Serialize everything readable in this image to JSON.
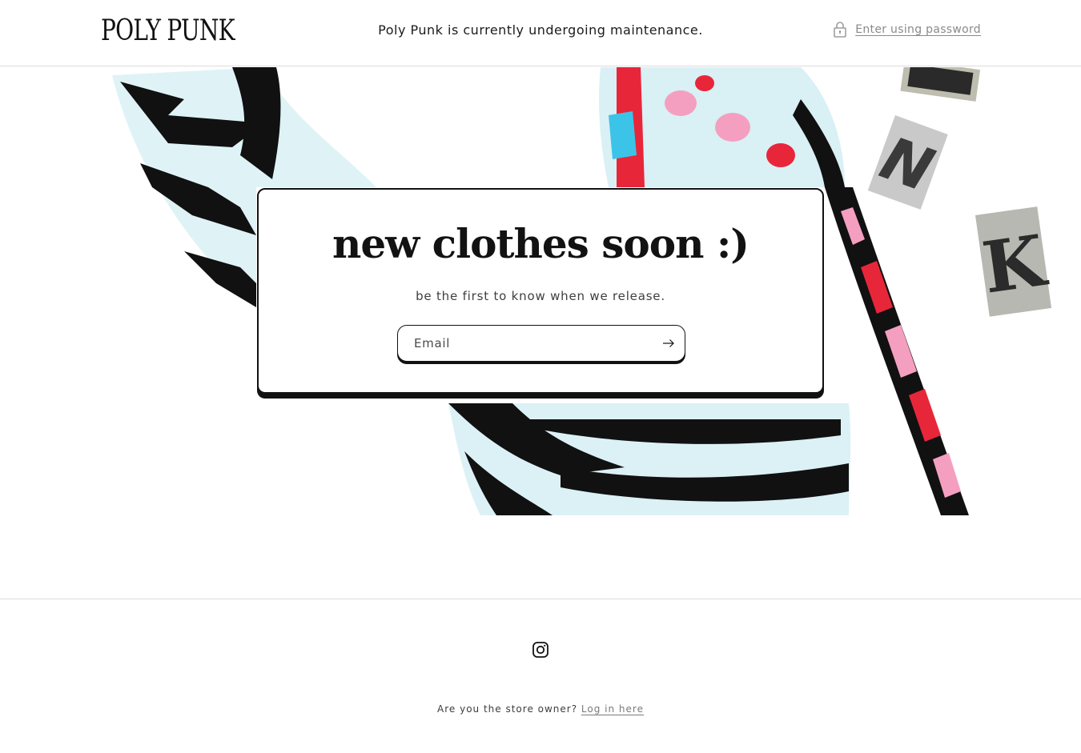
{
  "header": {
    "logo_text": "POLY PUNK",
    "maintenance_message": "Poly Punk is currently undergoing maintenance.",
    "password_link": "Enter using password",
    "password_icon": "lock-icon"
  },
  "hero": {
    "title": "new clothes soon :)",
    "subtitle": "be the first to know when we release.",
    "email_placeholder": "Email",
    "email_value": "",
    "submit_icon": "arrow-right-icon"
  },
  "footer": {
    "social_icon": "instagram-icon",
    "owner_question": "Are you the store owner?",
    "login_link": "Log in here"
  },
  "colors": {
    "text": "#121212",
    "muted": "#8a8a8a",
    "accent_red": "#e8263a",
    "accent_pink": "#f59fc0",
    "pattern_light": "#d8f2f7"
  }
}
